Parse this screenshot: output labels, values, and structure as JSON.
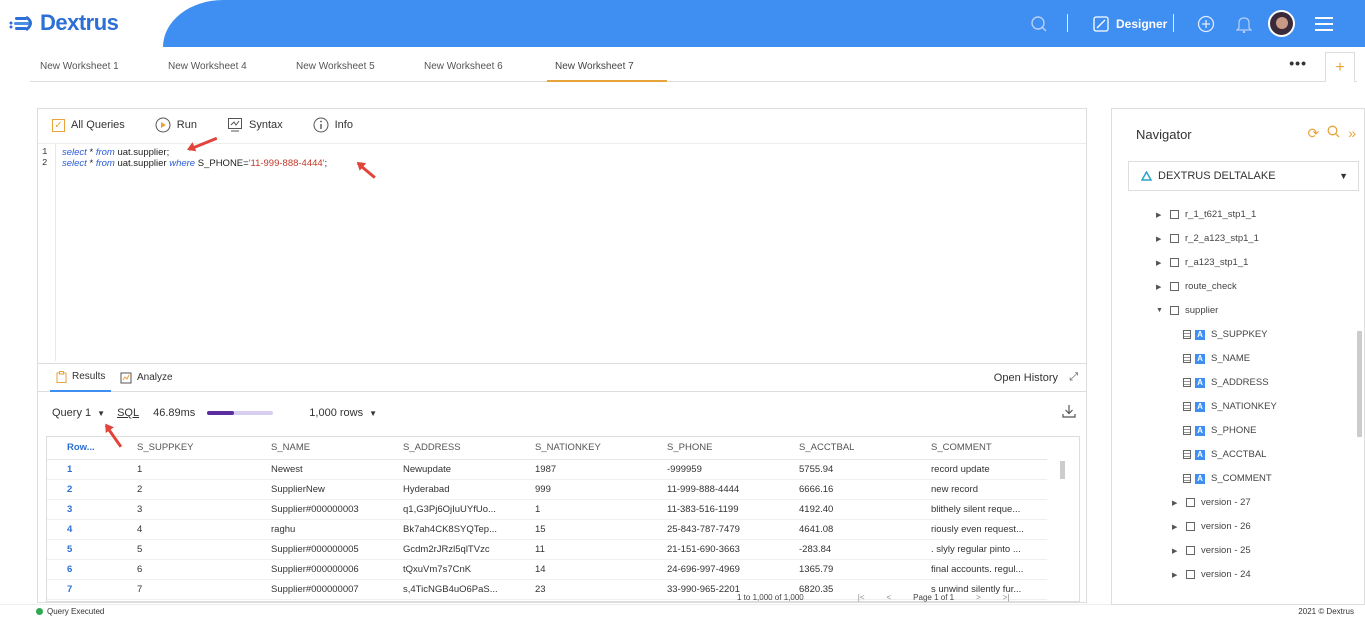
{
  "header": {
    "logo_text": "Dextrus",
    "designer_label": "Designer"
  },
  "tabs": [
    {
      "label": "New Worksheet 1"
    },
    {
      "label": "New Worksheet 4"
    },
    {
      "label": "New Worksheet 5"
    },
    {
      "label": "New Worksheet 6"
    },
    {
      "label": "New Worksheet 7"
    }
  ],
  "tabs_more": "•••",
  "tabs_add": "+",
  "editor": {
    "toolbar": {
      "all_queries": "All Queries",
      "run": "Run",
      "syntax": "Syntax",
      "info": "Info"
    },
    "lines": [
      {
        "num": "1",
        "kw1": "select",
        "mid1": " * ",
        "kw2": "from",
        "rest": "  uat.supplier;"
      },
      {
        "num": "2",
        "kw1": "select",
        "mid1": " * ",
        "kw2": "from",
        "rest": " uat.supplier ",
        "kw3": "where",
        "rest2": " S_PHONE=",
        "str": "'11-999-888-4444'",
        "end": ";"
      }
    ]
  },
  "results": {
    "tab_results": "Results",
    "tab_analyze": "Analyze",
    "open_history": "Open History",
    "query_label": "Query 1",
    "sql_link": "SQL",
    "time": "46.89ms",
    "progress_fraction": 0.4,
    "rows_select": "1,000 rows",
    "columns": [
      "Row...",
      "S_SUPPKEY",
      "S_NAME",
      "S_ADDRESS",
      "S_NATIONKEY",
      "S_PHONE",
      "S_ACCTBAL",
      "S_COMMENT"
    ],
    "rows": [
      [
        "1",
        "1",
        "Newest",
        "Newupdate",
        "1987",
        "-999959",
        "5755.94",
        "record update"
      ],
      [
        "2",
        "2",
        "SupplierNew",
        "Hyderabad",
        "999",
        "11-999-888-4444",
        "6666.16",
        "new record"
      ],
      [
        "3",
        "3",
        "Supplier#000000003",
        "q1,G3Pj6OjIuUYfUo...",
        "1",
        "11-383-516-1199",
        "4192.40",
        "blithely silent reque..."
      ],
      [
        "4",
        "4",
        "raghu",
        "Bk7ah4CK8SYQTep...",
        "15",
        "25-843-787-7479",
        "4641.08",
        "riously even request..."
      ],
      [
        "5",
        "5",
        "Supplier#000000005",
        "Gcdm2rJRzl5qlTVzc",
        "11",
        "21-151-690-3663",
        "-283.84",
        ". slyly regular pinto ..."
      ],
      [
        "6",
        "6",
        "Supplier#000000006",
        "tQxuVm7s7CnK",
        "14",
        "24-696-997-4969",
        "1365.79",
        "final accounts. regul..."
      ],
      [
        "7",
        "7",
        "Supplier#000000007",
        "s,4TicNGB4uO6PaS...",
        "23",
        "33-990-965-2201",
        "6820.35",
        "s unwind silently fur..."
      ]
    ],
    "pager": {
      "range": "1 to 1,000 of 1,000",
      "page_label": "Page",
      "page_num": "1",
      "of_label": "of",
      "total_pages": "1"
    }
  },
  "status": {
    "text": "Query Executed",
    "copyright": "2021 © Dextrus"
  },
  "navigator": {
    "title": "Navigator",
    "datasource": "DEXTRUS DELTALAKE",
    "tables": [
      "r_1_t621_stp1_1",
      "r_2_a123_stp1_1",
      "r_a123_stp1_1",
      "route_check",
      "supplier"
    ],
    "columns": [
      "S_SUPPKEY",
      "S_NAME",
      "S_ADDRESS",
      "S_NATIONKEY",
      "S_PHONE",
      "S_ACCTBAL",
      "S_COMMENT"
    ],
    "versions": [
      "version - 27",
      "version - 26",
      "version - 25",
      "version - 24"
    ]
  }
}
